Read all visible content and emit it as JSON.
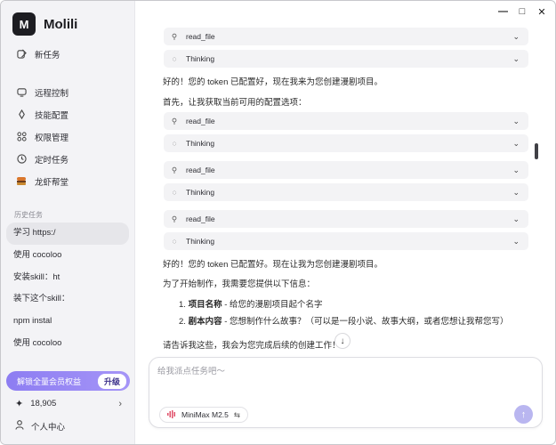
{
  "app": {
    "name": "Molili",
    "logo_letter": "M"
  },
  "window_controls": {
    "minimize": "—",
    "maximize": "□",
    "close": "✕"
  },
  "sidebar": {
    "new_task": "新任务",
    "menu": [
      {
        "label": "远程控制",
        "icon": "monitor-icon"
      },
      {
        "label": "技能配置",
        "icon": "skill-icon"
      },
      {
        "label": "权限管理",
        "icon": "grid-icon"
      },
      {
        "label": "定时任务",
        "icon": "clock-icon"
      },
      {
        "label": "龙虾帮堂",
        "icon": "lobster-icon"
      }
    ],
    "history_label": "历史任务",
    "history": [
      "学习 https:/",
      "使用 cocoloo",
      "安装skill：ht",
      "装下这个skill：",
      "npm instal",
      "使用 cocoloo"
    ],
    "promo": {
      "text": "解锁全量会员权益",
      "button": "升级"
    },
    "points": "18,905",
    "profile": "个人中心"
  },
  "chat": {
    "tools": [
      "read_file",
      "Thinking",
      "read_file",
      "Thinking",
      "read_file",
      "Thinking",
      "read_file",
      "Thinking"
    ],
    "msg1": "好的！您的 token 已配置好，现在我来为您创建漫剧项目。",
    "msg2": "首先，让我获取当前可用的配置选项：",
    "msg3": "好的！您的 token 已配置好。现在让我为您创建漫剧项目。",
    "msg4": "为了开始制作，我需要您提供以下信息：",
    "list": [
      {
        "num": "1.",
        "bold": "项目名称",
        "rest": " - 给您的漫剧项目起个名字"
      },
      {
        "num": "2.",
        "bold": "剧本内容",
        "rest": " - 您想制作什么故事？（可以是一段小说、故事大纲，或者您想让我帮您写）"
      }
    ],
    "msg5": "请告诉我这些，我会为您完成后续的创建工作！"
  },
  "composer": {
    "placeholder": "给我派点任务吧～",
    "model": "MiniMax M2.5"
  }
}
